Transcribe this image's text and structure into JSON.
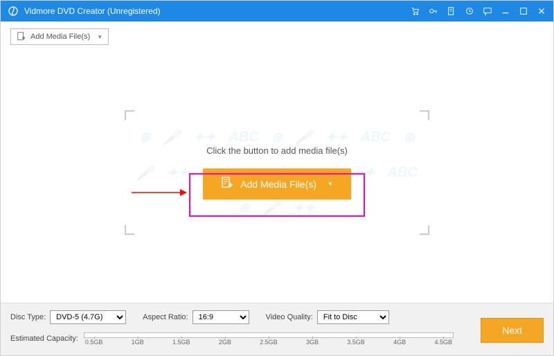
{
  "titlebar": {
    "title": "Vidmore DVD Creator (Unregistered)"
  },
  "toolbar": {
    "add_media_label": "Add Media File(s)"
  },
  "main": {
    "hint": "Click the button to add media file(s)",
    "add_media_button": "Add Media File(s)"
  },
  "footer": {
    "disc_type_label": "Disc Type:",
    "disc_type_value": "DVD-5 (4.7G)",
    "aspect_ratio_label": "Aspect Ratio:",
    "aspect_ratio_value": "16:9",
    "video_quality_label": "Video Quality:",
    "video_quality_value": "Fit to Disc",
    "capacity_label": "Estimated Capacity:",
    "ticks": [
      "0.5GB",
      "1GB",
      "1.5GB",
      "2GB",
      "2.5GB",
      "3GB",
      "3.5GB",
      "4GB",
      "4.5GB"
    ],
    "next_label": "Next"
  },
  "sel_widths": {
    "disc": "110px",
    "aspect": "82px",
    "quality": "104px"
  }
}
